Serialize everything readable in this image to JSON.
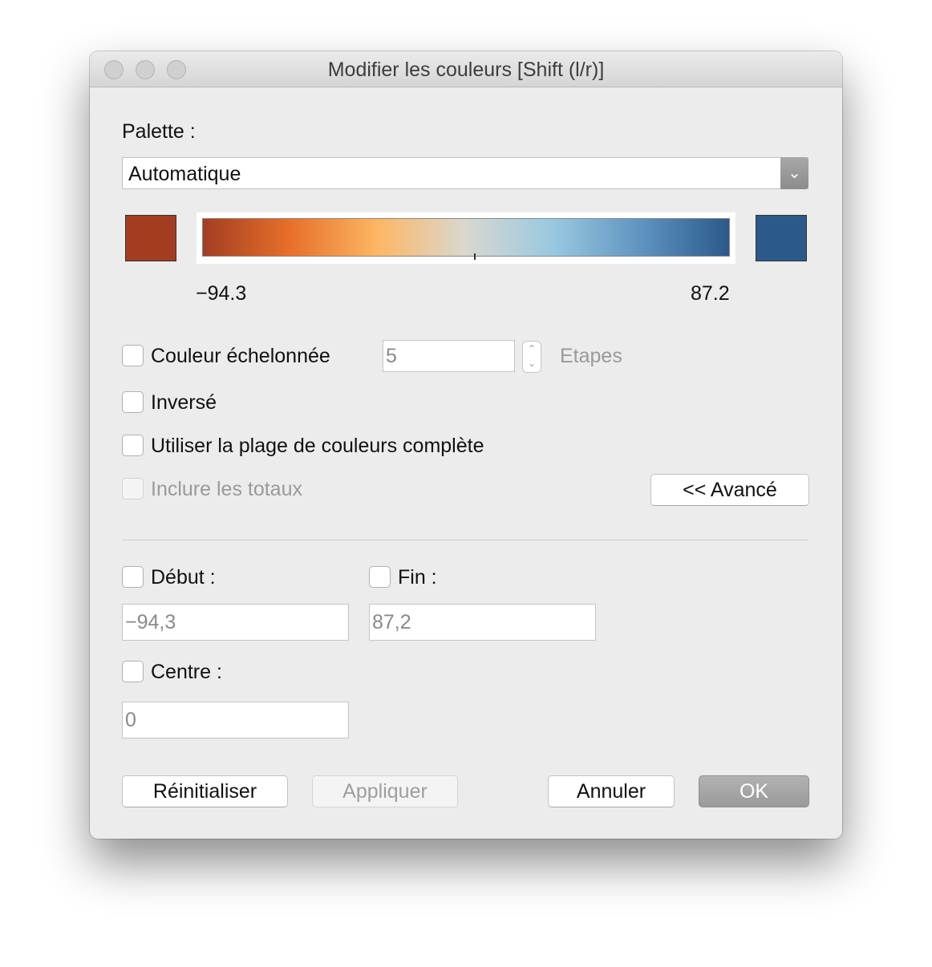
{
  "window": {
    "title": "Modifier les couleurs [Shift (l/r)]"
  },
  "palette": {
    "label": "Palette :",
    "selected": "Automatique",
    "start_color": "#a33d22",
    "end_color": "#2b5a8a",
    "gradient_stops": [
      "#a33d22",
      "#e8702a",
      "#fdb765",
      "#d8d8d0",
      "#98c8e0",
      "#5f93c0",
      "#2b5a8a"
    ],
    "min_label": "−94.3",
    "max_label": "87.2"
  },
  "options": {
    "stepped_label": "Couleur échelonnée",
    "steps_value": "5",
    "steps_label": "Etapes",
    "reversed_label": "Inversé",
    "full_range_label": "Utiliser la plage de couleurs complète",
    "include_totals_label": "Inclure les totaux",
    "advanced_button": "<< Avancé"
  },
  "advanced": {
    "start_label": "Début :",
    "start_value": "−94,3",
    "end_label": "Fin :",
    "end_value": "87,2",
    "center_label": "Centre :",
    "center_value": "0"
  },
  "buttons": {
    "reset": "Réinitialiser",
    "apply": "Appliquer",
    "cancel": "Annuler",
    "ok": "OK"
  }
}
